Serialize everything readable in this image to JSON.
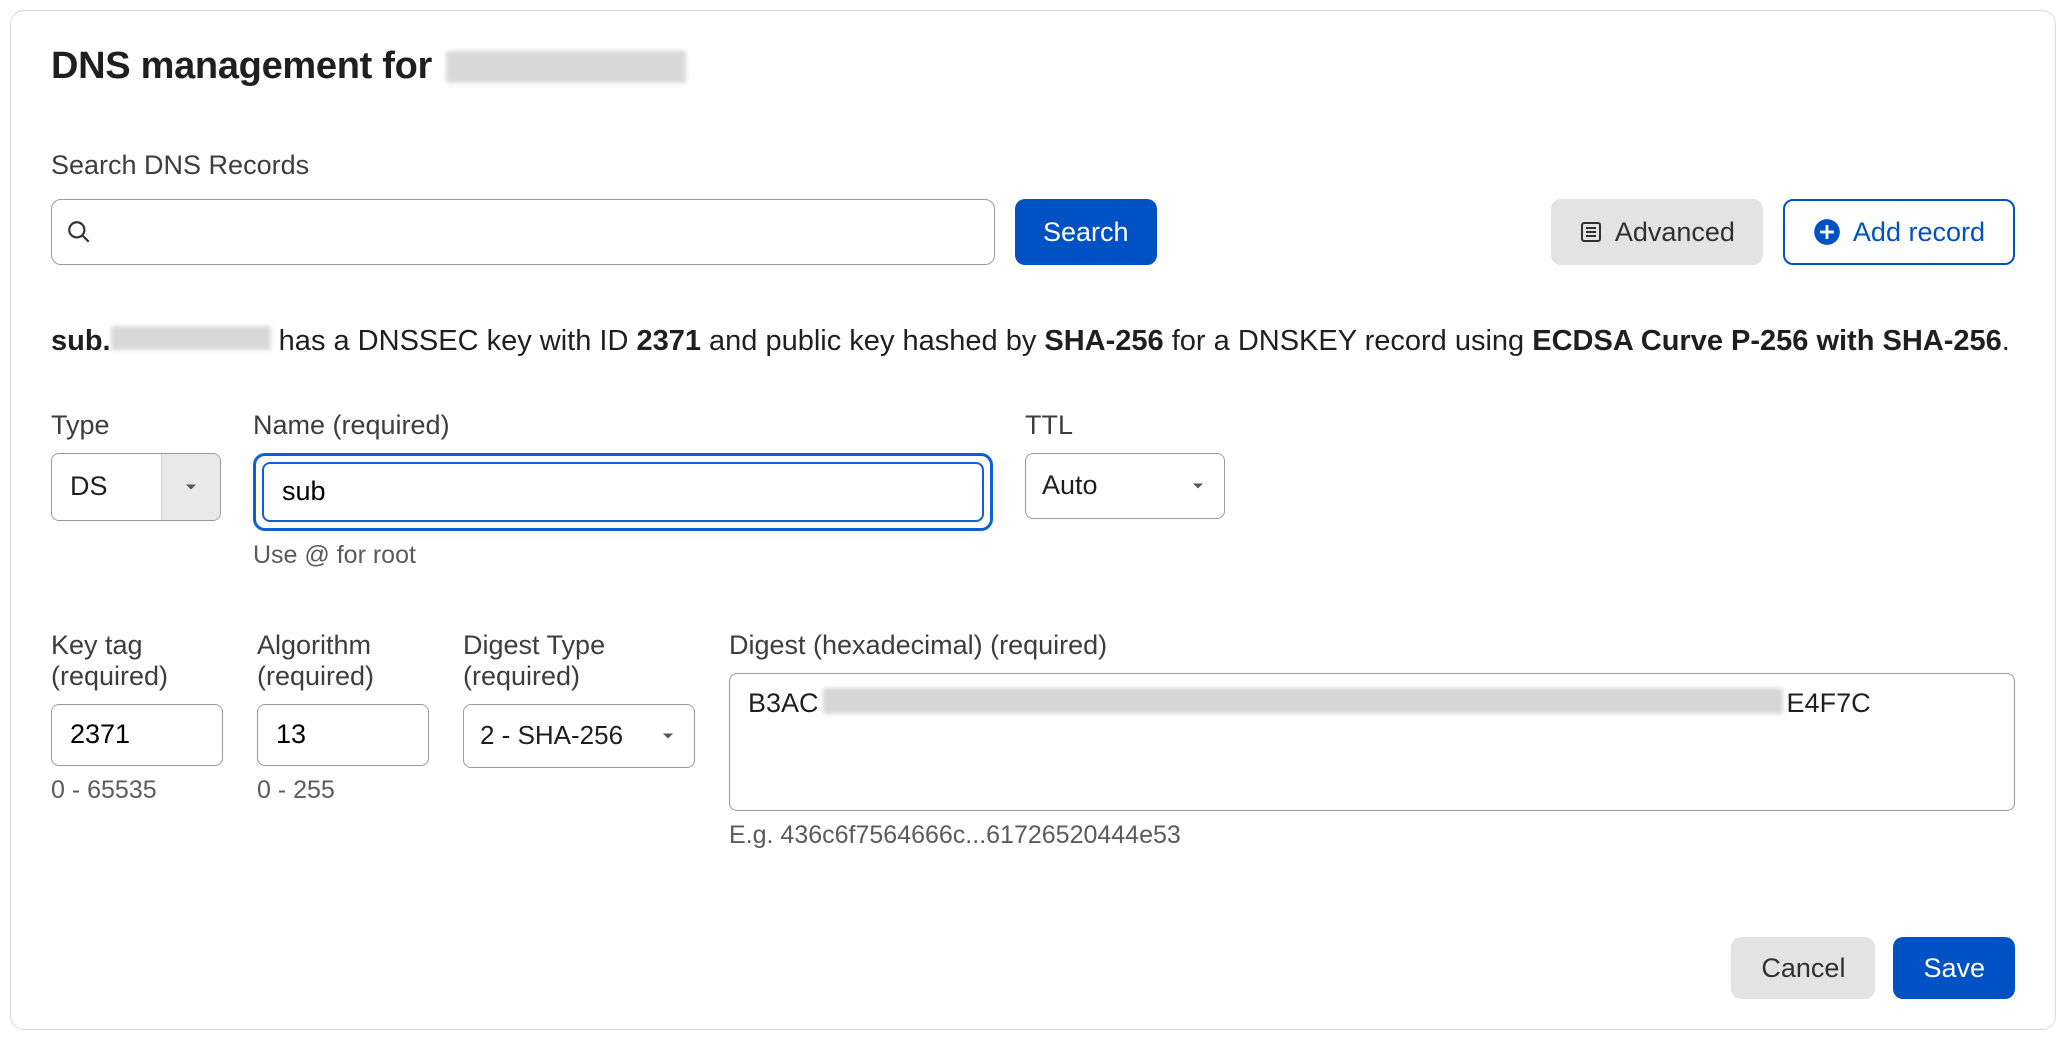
{
  "title_prefix": "DNS management for ",
  "search": {
    "label": "Search DNS Records",
    "button": "Search",
    "advanced": "Advanced",
    "add": "Add record"
  },
  "description": {
    "p1_bold": "sub.",
    "p1_rest": " has a DNSSEC key with ID ",
    "id": "2371",
    "p2": " and public key hashed by ",
    "hash": "SHA-256",
    "p3": " for a DNSKEY record using ",
    "alg": "ECDSA Curve P-256 with SHA-256",
    "end": "."
  },
  "labels": {
    "type": "Type",
    "name": "Name (required)",
    "name_hint": "Use @ for root",
    "ttl": "TTL",
    "key_tag": "Key tag (required)",
    "key_tag_hint": "0 - 65535",
    "algorithm": "Algorithm (required)",
    "algorithm_hint": "0 - 255",
    "digest_type": "Digest Type (required)",
    "digest": "Digest (hexadecimal) (required)",
    "digest_hint": "E.g. 436c6f7564666c...61726520444e53"
  },
  "values": {
    "type": "DS",
    "name": "sub",
    "ttl": "Auto",
    "key_tag": "2371",
    "algorithm": "13",
    "digest_type": "2 - SHA-256",
    "digest_prefix": "B3AC",
    "digest_suffix": "E4F7C"
  },
  "actions": {
    "cancel": "Cancel",
    "save": "Save"
  }
}
